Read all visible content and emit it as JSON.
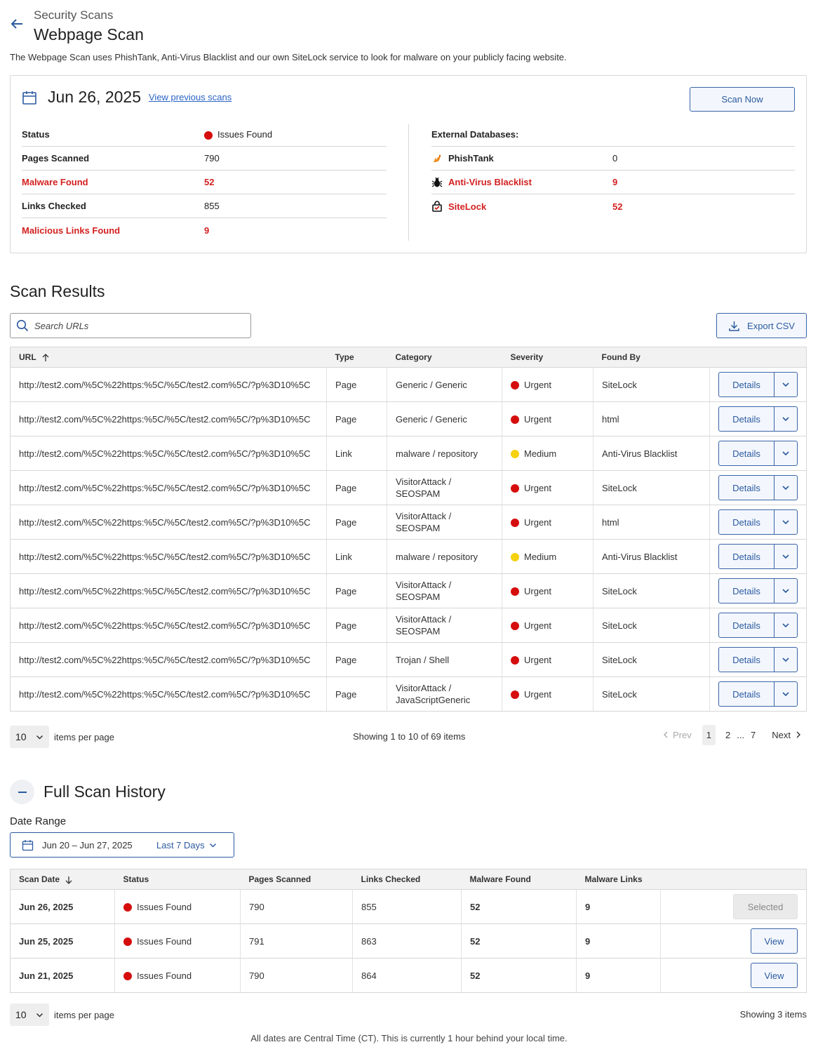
{
  "header": {
    "breadcrumb": "Security Scans",
    "title": "Webpage Scan",
    "description": "The Webpage Scan uses PhishTank, Anti-Virus Blacklist and our own SiteLock service to look for malware on your publicly facing website."
  },
  "summary": {
    "date": "Jun 26, 2025",
    "view_previous": "View previous scans",
    "scan_now": "Scan Now",
    "rows": [
      {
        "label": "Status",
        "value": "Issues Found"
      },
      {
        "label": "Pages Scanned",
        "value": "790"
      },
      {
        "label": "Malware Found",
        "value": "52"
      },
      {
        "label": "Links Checked",
        "value": "855"
      },
      {
        "label": "Malicious Links Found",
        "value": "9"
      }
    ],
    "external_label": "External Databases:",
    "databases": [
      {
        "label": "PhishTank",
        "value": "0",
        "icon": "phishtank-icon"
      },
      {
        "label": "Anti-Virus Blacklist",
        "value": "9",
        "icon": "bug-icon"
      },
      {
        "label": "SiteLock",
        "value": "52",
        "icon": "sitelock-icon"
      }
    ]
  },
  "results": {
    "title": "Scan Results",
    "search_placeholder": "Search URLs",
    "export": "Export CSV",
    "columns": [
      "URL",
      "Type",
      "Category",
      "Severity",
      "Found By"
    ],
    "details_label": "Details",
    "rows": [
      {
        "url": "http://test2.com/%5C%22https:%5C/%5C/test2.com%5C/?p%3D10%5C",
        "type": "Page",
        "category": "Generic / Generic",
        "severity": "Urgent",
        "found_by": "SiteLock"
      },
      {
        "url": "http://test2.com/%5C%22https:%5C/%5C/test2.com%5C/?p%3D10%5C",
        "type": "Page",
        "category": "Generic / Generic",
        "severity": "Urgent",
        "found_by": "html"
      },
      {
        "url": "http://test2.com/%5C%22https:%5C/%5C/test2.com%5C/?p%3D10%5C",
        "type": "Link",
        "category": "malware / repository",
        "severity": "Medium",
        "found_by": "Anti-Virus Blacklist"
      },
      {
        "url": "http://test2.com/%5C%22https:%5C/%5C/test2.com%5C/?p%3D10%5C",
        "type": "Page",
        "category": "VisitorAttack / SEOSPAM",
        "severity": "Urgent",
        "found_by": "SiteLock"
      },
      {
        "url": "http://test2.com/%5C%22https:%5C/%5C/test2.com%5C/?p%3D10%5C",
        "type": "Page",
        "category": "VisitorAttack / SEOSPAM",
        "severity": "Urgent",
        "found_by": "html"
      },
      {
        "url": "http://test2.com/%5C%22https:%5C/%5C/test2.com%5C/?p%3D10%5C",
        "type": "Link",
        "category": "malware / repository",
        "severity": "Medium",
        "found_by": "Anti-Virus Blacklist"
      },
      {
        "url": "http://test2.com/%5C%22https:%5C/%5C/test2.com%5C/?p%3D10%5C",
        "type": "Page",
        "category": "VisitorAttack / SEOSPAM",
        "severity": "Urgent",
        "found_by": "SiteLock"
      },
      {
        "url": "http://test2.com/%5C%22https:%5C/%5C/test2.com%5C/?p%3D10%5C",
        "type": "Page",
        "category": "VisitorAttack / SEOSPAM",
        "severity": "Urgent",
        "found_by": "SiteLock"
      },
      {
        "url": "http://test2.com/%5C%22https:%5C/%5C/test2.com%5C/?p%3D10%5C",
        "type": "Page",
        "category": "Trojan / Shell",
        "severity": "Urgent",
        "found_by": "SiteLock"
      },
      {
        "url": "http://test2.com/%5C%22https:%5C/%5C/test2.com%5C/?p%3D10%5C",
        "type": "Page",
        "category": "VisitorAttack / JavaScriptGeneric",
        "severity": "Urgent",
        "found_by": "SiteLock"
      }
    ],
    "per_page": "10",
    "per_page_label": "items per page",
    "showing": "Showing 1 to 10 of 69 items",
    "pager": {
      "prev": "Prev",
      "pages": [
        "1",
        "2",
        "...",
        "7"
      ],
      "next": "Next"
    }
  },
  "history": {
    "title": "Full Scan History",
    "range_label": "Date Range",
    "range_value": "Jun 20 – Jun 27, 2025",
    "range_preset": "Last 7 Days",
    "columns": [
      "Scan Date",
      "Status",
      "Pages Scanned",
      "Links Checked",
      "Malware Found",
      "Malware Links"
    ],
    "rows": [
      {
        "date": "Jun 26, 2025",
        "status": "Issues Found",
        "pages": "790",
        "links": "855",
        "malware": "52",
        "malware_links": "9",
        "action": "Selected"
      },
      {
        "date": "Jun 25, 2025",
        "status": "Issues Found",
        "pages": "791",
        "links": "863",
        "malware": "52",
        "malware_links": "9",
        "action": "View"
      },
      {
        "date": "Jun 21, 2025",
        "status": "Issues Found",
        "pages": "790",
        "links": "864",
        "malware": "52",
        "malware_links": "9",
        "action": "View"
      }
    ],
    "per_page": "10",
    "per_page_label": "items per page",
    "showing": "Showing 3 items"
  },
  "footer_note": "All dates are Central Time (CT). This is currently 1 hour behind your local time.",
  "colors": {
    "accent": "#2c5aa0",
    "danger": "#d32020",
    "warning": "#f5d10f"
  }
}
